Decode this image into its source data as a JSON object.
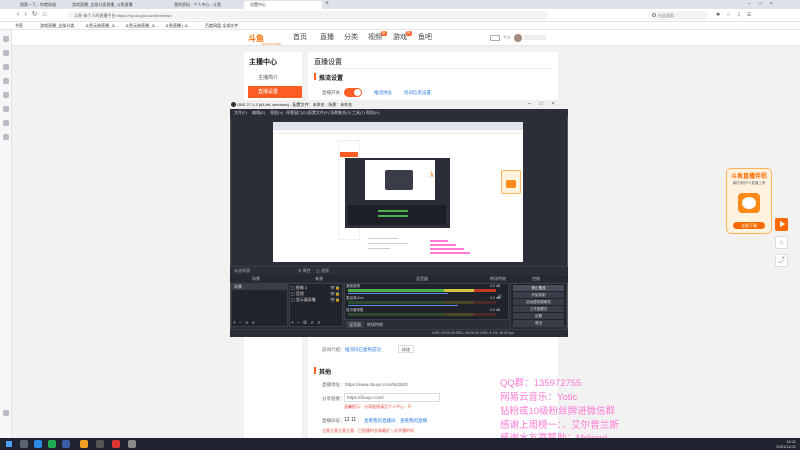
{
  "browser": {
    "tabs": [
      {
        "label": "搜索一下，你就知道"
      },
      {
        "label": "游戏直播_全部分类直播_斗鱼直播"
      },
      {
        "label": "我的资料 - 个人中心 - 斗鱼"
      },
      {
        "label": "设置中心"
      }
    ],
    "address": "斗鱼·每个人的直播平台 https://mp.douyu.com/live/main",
    "search_placeholder": "在此搜索",
    "bookmarks": [
      "书签",
      "游戏直播_全部分类",
      "斗鱼无效直播_斗…",
      "斗鱼无效直播_斗…",
      "斗鱼直播 | 斗…",
      "百度网盘-全部文件"
    ],
    "user_label": "个人",
    "accent": "#2b7be6"
  },
  "site": {
    "logo": "斗鱼",
    "logo_sub": "DOUYU.COM",
    "nav": [
      "首页",
      "直播",
      "分类",
      "视频",
      "游戏",
      "鱼吧"
    ],
    "nav_badges": [
      "",
      "",
      "",
      "新",
      "热",
      ""
    ],
    "accent": "#ff5d23"
  },
  "sidebar": {
    "title": "主播中心",
    "items": [
      {
        "label": "主播简介"
      },
      {
        "label": "直播设置"
      }
    ]
  },
  "content": {
    "page_title": "直播设置",
    "section1": "推流设置",
    "toggle_label": "直播开关：",
    "link1": "推流地址",
    "link2": "房间信息设置",
    "row_label_a": "房间介绍：",
    "row_link_a": "推流码已复制成功",
    "row_btn_a": "修改",
    "section2": "其他",
    "row_b_label": "直播地址：",
    "row_b_value": "https://www.douyu.com/642923",
    "row_c_label": "分享链接：",
    "row_c_value": "https://douyu.com/",
    "row_c_hint": "温馨提示：分享链接请至个人中心 - 开",
    "row_d_label": "直播间号：",
    "row_d_value": "12 11",
    "row_d_link1": "查看我的直播间",
    "row_d_link2": "查看我的直播",
    "row_e_red": "注意注意注意注意，已直播时长和最近一次开播时间"
  },
  "obs": {
    "title": "OBS 27.1.3 (64-bit, windows) - 配置文件：未命名 - 场景：未命名",
    "menu": [
      "文件(F)",
      "编辑(E)",
      "视图(V)",
      "停靠窗口(D)",
      "配置文件(P)",
      "场景集合(S)",
      "工具(T)",
      "帮助(H)"
    ],
    "source_bar": "未选择源",
    "properties": "属性",
    "filters": "滤镜",
    "docks": [
      "场景",
      "来源",
      "混音器",
      "转场特效",
      "控制"
    ],
    "scene_item": "场景",
    "sources": [
      "图像 2",
      "音频",
      "显示器采集"
    ],
    "mixer": [
      {
        "name": "桌面音频",
        "db": "0.0 dB"
      },
      {
        "name": "麦克风/Aux",
        "db": "0.0 dB"
      },
      {
        "name": "显示器采集",
        "db": "0.0 dB"
      }
    ],
    "transition": "淡入淡出",
    "controls": [
      "停止推流",
      "开始录制",
      "启动虚拟摄像机",
      "工作室模式",
      "设置",
      "退出"
    ],
    "mixer_tabs": [
      "混音器",
      "转场特效"
    ],
    "status": "LIVE: 00:00:49   REC: 00:00:00   CPU: 3.1%, 30.00 fps"
  },
  "overlay": {
    "line1": "QQ群：135972755",
    "line2": "网易云音乐：Yotic",
    "line3": "钻粉或10级粉丝牌进微信群",
    "line4": "感谢上周榜一：、艾尔普兰斯",
    "line5": "感谢水友赛赞助：Mrlinnd",
    "color": "#ff7ad6"
  },
  "promo": {
    "title": "斗鱼直播伴侣",
    "sub": "最好用的PC直播工具",
    "btn": "立即下载"
  },
  "taskbar": {
    "time": "16:11",
    "date": "2021/11/21"
  }
}
